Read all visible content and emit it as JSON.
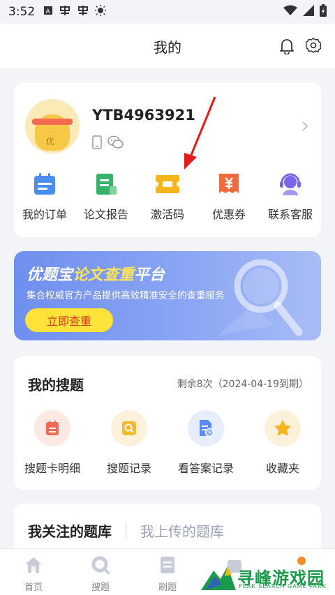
{
  "status_bar": {
    "time": "3:52"
  },
  "header": {
    "title": "我的"
  },
  "profile": {
    "username": "YTB4963921",
    "avatar_glyph": "优"
  },
  "quick_actions": [
    {
      "label": "我的订单",
      "icon": "calendar-icon",
      "color": "#4a8df0"
    },
    {
      "label": "论文报告",
      "icon": "document-icon",
      "color": "#36b36b"
    },
    {
      "label": "激活码",
      "icon": "ticket-icon",
      "color": "#f5b51b"
    },
    {
      "label": "优惠券",
      "icon": "coupon-icon",
      "color": "#f46a3a"
    },
    {
      "label": "联系客服",
      "icon": "headset-icon",
      "color": "#7a66e8"
    }
  ],
  "banner": {
    "title_main": "优题宝",
    "title_highlight": "论文查重",
    "title_tail": "平台",
    "subtitle": "集合权威官方产品提供高效精准安全的查重服务",
    "button": "立即查重"
  },
  "my_search": {
    "title": "我的搜题",
    "remaining": "剩余8次（2024-04-19到期）",
    "items": [
      {
        "label": "搜题卡明细",
        "icon": "card-detail-icon",
        "bg": "#fde9e4",
        "color": "#f26a55"
      },
      {
        "label": "搜题记录",
        "icon": "search-record-icon",
        "bg": "#fdf1dc",
        "color": "#f5b92e"
      },
      {
        "label": "看答案记录",
        "icon": "answer-record-icon",
        "bg": "#e6eefc",
        "color": "#5b8bf0"
      },
      {
        "label": "收藏夹",
        "icon": "star-icon",
        "bg": "#fdf1dc",
        "color": "#f5b51b"
      }
    ]
  },
  "question_bank": {
    "tab_followed": "我关注的题库",
    "tab_uploaded": "我上传的题库"
  },
  "bottom_nav": [
    {
      "label": "首页",
      "icon": "home-icon"
    },
    {
      "label": "搜题",
      "icon": "search-icon"
    },
    {
      "label": "刷题",
      "icon": "practice-icon"
    },
    {
      "label": "",
      "icon": "library-icon"
    },
    {
      "label": "",
      "icon": "profile-icon"
    }
  ],
  "watermark": {
    "text": "寻峰游戏园",
    "sub": "PEAK SEARCH GAME PARK"
  }
}
